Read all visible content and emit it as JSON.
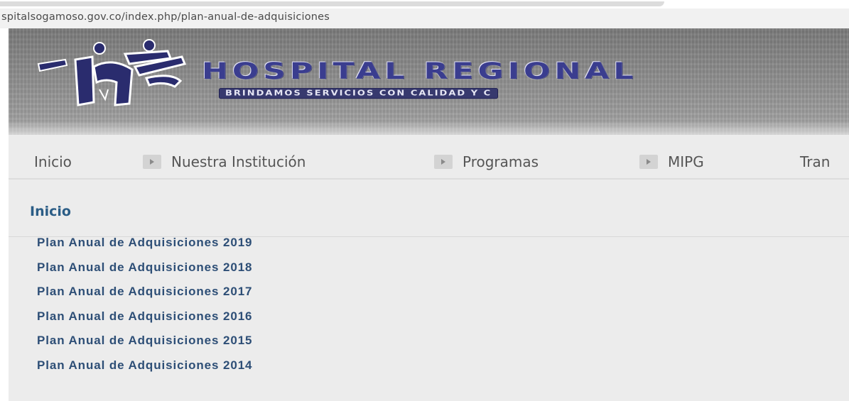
{
  "browser": {
    "url": "spitalsogamoso.gov.co/index.php/plan-anual-de-adquisiciones"
  },
  "header": {
    "title": "HOSPITAL REGIONAL",
    "slogan": "BRINDAMOS SERVICIOS CON CALIDAD Y C",
    "logo_icon": "hospital-logo-icon",
    "brand_color": "#3a3d8f"
  },
  "nav": {
    "items": [
      {
        "label": "Inicio",
        "icon": null
      },
      {
        "label": "Nuestra Institución",
        "icon": "play-arrow-icon"
      },
      {
        "label": "Programas",
        "icon": "play-arrow-icon"
      },
      {
        "label": "MIPG",
        "icon": "play-arrow-icon"
      },
      {
        "label": "Tran",
        "icon": null
      }
    ]
  },
  "main": {
    "page_title": "Inicio",
    "title_color": "#2b5d86",
    "link_color": "#2d4e76",
    "links": [
      "Plan Anual de Adquisiciones 2019",
      "Plan Anual de Adquisiciones 2018",
      "Plan Anual de Adquisiciones 2017",
      "Plan Anual de Adquisiciones 2016",
      "Plan Anual de Adquisiciones 2015",
      "Plan Anual de Adquisiciones 2014"
    ]
  }
}
